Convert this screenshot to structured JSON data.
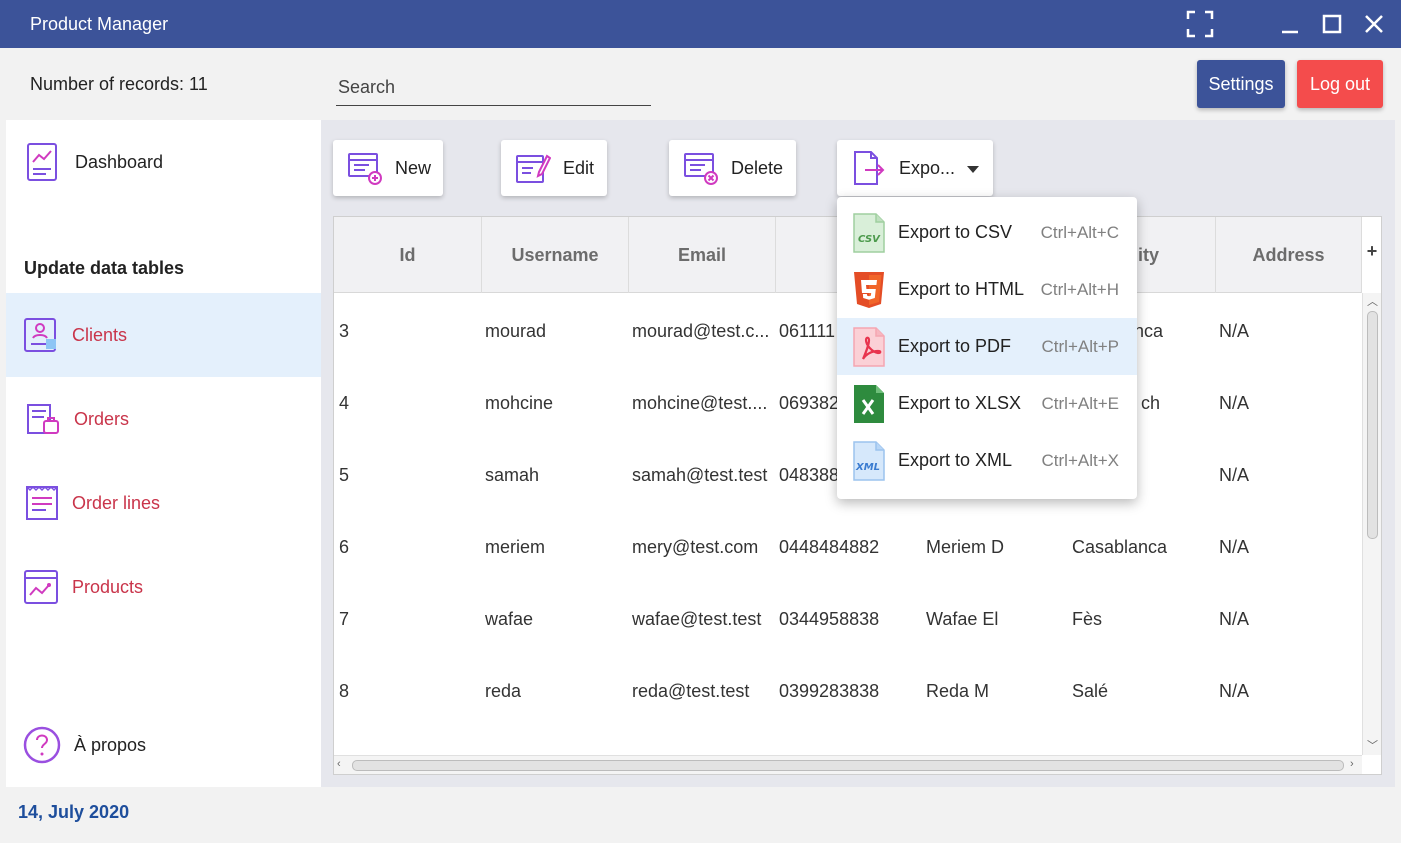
{
  "window": {
    "title": "Product Manager"
  },
  "top": {
    "records_text": "Number of records: 11",
    "search_placeholder": "Search",
    "settings_label": "Settings",
    "logout_label": "Log out"
  },
  "sidebar": {
    "dashboard": "Dashboard",
    "section_title": "Update data tables",
    "items": [
      {
        "label": "Clients",
        "icon": "clients-icon",
        "active": true
      },
      {
        "label": "Orders",
        "icon": "orders-icon"
      },
      {
        "label": "Order lines",
        "icon": "order-lines-icon"
      },
      {
        "label": "Products",
        "icon": "products-icon"
      }
    ],
    "about": "À propos"
  },
  "footer": {
    "date": "14, July 2020"
  },
  "toolbar": {
    "new_label": "New",
    "edit_label": "Edit",
    "delete_label": "Delete",
    "export_label": "Expo..."
  },
  "table": {
    "columns": [
      "Id",
      "Username",
      "Email",
      "",
      "",
      "ity",
      "Address"
    ],
    "rows": [
      [
        "3",
        "mourad",
        "mourad@test.c...",
        "061111",
        "",
        "nca",
        "N/A"
      ],
      [
        "4",
        "mohcine",
        "mohcine@test....",
        "069382",
        "",
        "ch",
        "N/A"
      ],
      [
        "5",
        "samah",
        "samah@test.test",
        "048388",
        "",
        "",
        "N/A"
      ],
      [
        "6",
        "meriem",
        "mery@test.com",
        "0448484882",
        "Meriem D",
        "Casablanca",
        "N/A"
      ],
      [
        "7",
        "wafae",
        "wafae@test.test",
        "0344958838",
        "Wafae El",
        "Fès",
        "N/A"
      ],
      [
        "8",
        "reda",
        "reda@test.test",
        "0399283838",
        "Reda M",
        "Salé",
        "N/A"
      ]
    ]
  },
  "export_menu": {
    "items": [
      {
        "label": "Export to CSV",
        "shortcut": "Ctrl+Alt+C",
        "icon": "csv-file-icon"
      },
      {
        "label": "Export to HTML",
        "shortcut": "Ctrl+Alt+H",
        "icon": "html5-icon"
      },
      {
        "label": "Export to PDF",
        "shortcut": "Ctrl+Alt+P",
        "icon": "pdf-file-icon",
        "highlighted": true
      },
      {
        "label": "Export to XLSX",
        "shortcut": "Ctrl+Alt+E",
        "icon": "excel-file-icon"
      },
      {
        "label": "Export to XML",
        "shortcut": "Ctrl+Alt+X",
        "icon": "xml-file-icon"
      }
    ]
  },
  "colors": {
    "titlebar": "#3c5399",
    "logout": "#f44c4c",
    "nav_text": "#c9344a",
    "date": "#1e4e9c",
    "active_bg": "#e4f0fc"
  }
}
